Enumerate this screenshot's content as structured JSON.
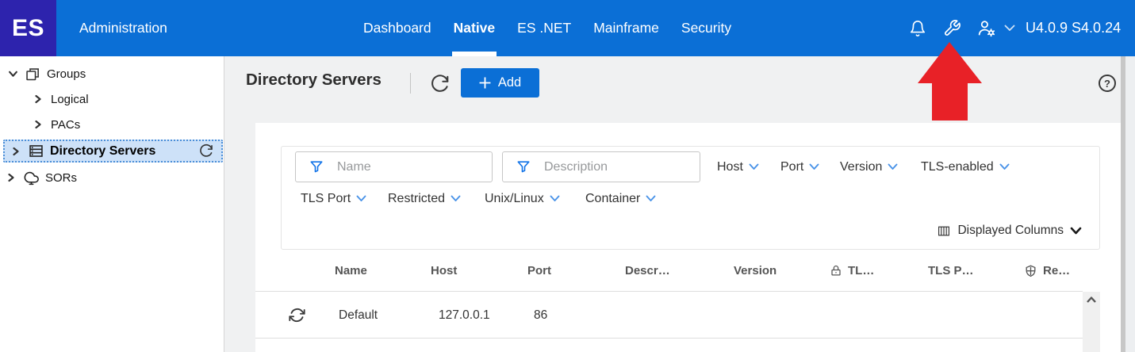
{
  "topbar": {
    "logo_text": "ES",
    "app_title": "Administration",
    "tabs": [
      {
        "label": "Dashboard",
        "active": false
      },
      {
        "label": "Native",
        "active": true
      },
      {
        "label": "ES .NET",
        "active": false
      },
      {
        "label": "Mainframe",
        "active": false
      },
      {
        "label": "Security",
        "active": false
      }
    ],
    "icons": [
      "bell-icon",
      "wrench-icon",
      "user-settings-icon",
      "chevron-down-icon"
    ],
    "version_text": "U4.0.9 S4.0.24"
  },
  "sidebar": {
    "items": [
      {
        "label": "Groups",
        "expanded": true
      },
      {
        "label": "Logical"
      },
      {
        "label": "PACs"
      },
      {
        "label": "Directory Servers",
        "selected": true
      },
      {
        "label": "SORs"
      }
    ]
  },
  "page": {
    "title": "Directory Servers",
    "add_button_label": "Add",
    "help_label": "?"
  },
  "filters": {
    "name_placeholder": "Name",
    "description_placeholder": "Description",
    "row1": [
      "Host",
      "Port",
      "Version",
      "TLS-enabled"
    ],
    "row2": [
      "TLS Port",
      "Restricted",
      "Unix/Linux",
      "Container"
    ],
    "displayed_columns_label": "Displayed Columns"
  },
  "table": {
    "columns": [
      "Name",
      "Host",
      "Port",
      "Descr…",
      "Version",
      "TL…",
      "TLS P…",
      "Re…"
    ],
    "rows": [
      {
        "name": "Default",
        "host": "127.0.0.1",
        "port": "86"
      }
    ]
  },
  "annotation": {
    "type": "red-arrow-up",
    "points_at": "wrench-icon"
  },
  "colors": {
    "topbar_blue": "#0b6fd6",
    "logo_indigo": "#2d23ad",
    "accent_blue": "#1173e8",
    "selected_item_bg": "#cde1f8",
    "arrow_red": "#e82127"
  }
}
